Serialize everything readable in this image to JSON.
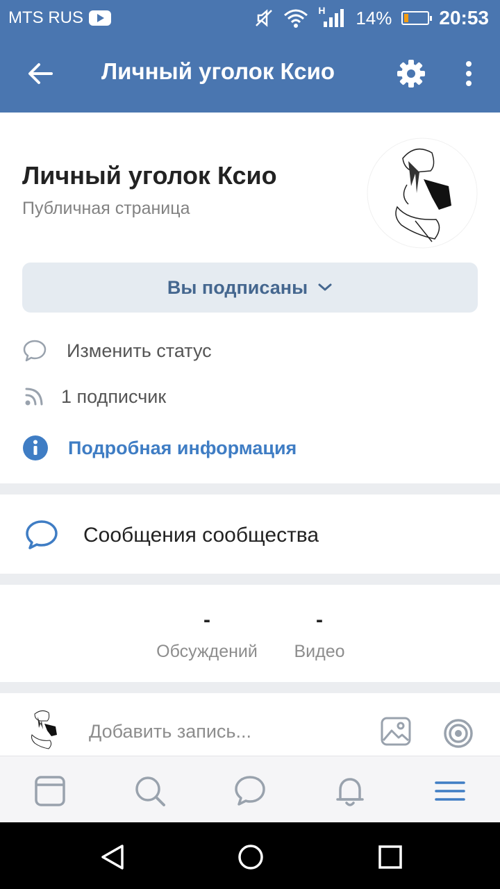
{
  "status_bar": {
    "carrier": "MTS RUS",
    "network": "H",
    "battery": "14%",
    "battery_level": 0.14,
    "time": "20:53"
  },
  "header": {
    "title": "Личный уголок Ксио",
    "icons": [
      "arrow-back-icon",
      "gear-icon",
      "more-vertical-icon"
    ]
  },
  "community": {
    "name": "Личный уголок Ксио",
    "type": "Публичная страница",
    "subscribe_button": "Вы подписаны",
    "status_action": "Изменить статус",
    "subscribers": "1 подписчик",
    "details_link": "Подробная информация",
    "accent_color": "#3f7dc4"
  },
  "messages": {
    "label": "Сообщения сообщества"
  },
  "stats": [
    {
      "value": "-",
      "label": "Обсуждений"
    },
    {
      "value": "-",
      "label": "Видео"
    }
  ],
  "composer": {
    "placeholder": "Добавить запись..."
  },
  "tabbar": {
    "items": [
      "news-icon",
      "search-icon",
      "messages-icon",
      "notifications-icon",
      "menu-icon"
    ],
    "active": "menu-icon"
  },
  "navbar": {
    "items": [
      "back-triangle-icon",
      "home-circle-icon",
      "recents-square-icon"
    ]
  }
}
